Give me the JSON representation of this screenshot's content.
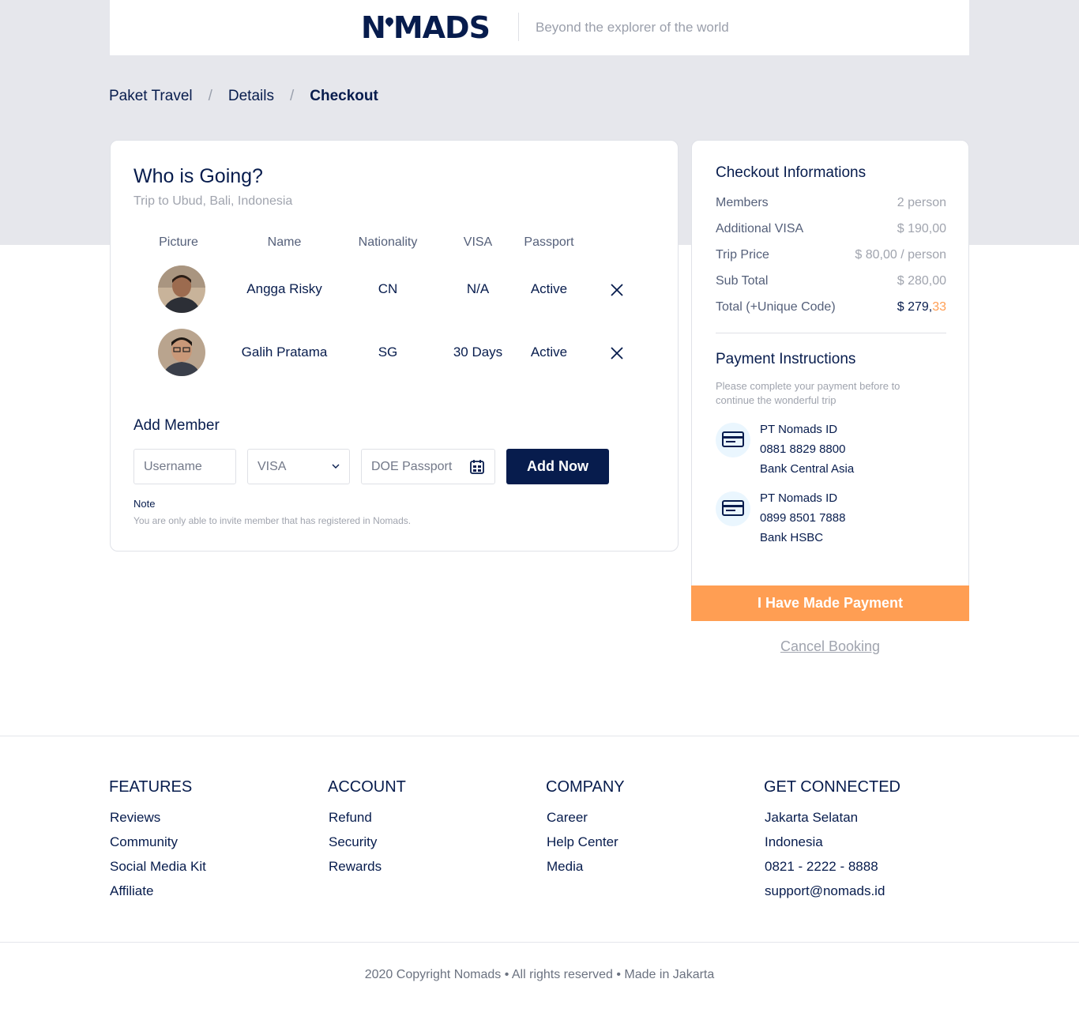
{
  "brand": {
    "logo_text_left": "N",
    "logo_text_right": "MADS",
    "tagline": "Beyond the explorer of the world"
  },
  "breadcrumb": {
    "items": [
      "Paket Travel",
      "Details",
      "Checkout"
    ],
    "separator": "/"
  },
  "who_going": {
    "title": "Who is Going?",
    "subtitle": "Trip to Ubud, Bali, Indonesia",
    "columns": [
      "Picture",
      "Name",
      "Nationality",
      "VISA",
      "Passport"
    ],
    "members": [
      {
        "name": "Angga Risky",
        "nationality": "CN",
        "visa": "N/A",
        "passport": "Active"
      },
      {
        "name": "Galih Pratama",
        "nationality": "SG",
        "visa": "30 Days",
        "passport": "Active"
      }
    ]
  },
  "add_member": {
    "title": "Add Member",
    "username_placeholder": "Username",
    "visa_selected": "VISA",
    "passport_placeholder": "DOE Passport",
    "button": "Add Now",
    "note_title": "Note",
    "note_text": "You are only able to invite member that has registered in Nomads."
  },
  "checkout": {
    "title": "Checkout Informations",
    "rows": [
      {
        "label": "Members",
        "value": "2 person"
      },
      {
        "label": "Additional VISA",
        "value": "$ 190,00"
      },
      {
        "label": "Trip Price",
        "value": "$ 80,00 / person"
      },
      {
        "label": "Sub Total",
        "value": "$ 280,00"
      }
    ],
    "total_label": "Total (+Unique Code)",
    "total_main": "$ 279,",
    "total_unique": "33",
    "accent_color": "#ff9e53"
  },
  "payment": {
    "title": "Payment Instructions",
    "note": "Please complete your payment before to continue the wonderful trip",
    "banks": [
      {
        "name": "PT Nomads ID",
        "account": "0881 8829 8800",
        "bank": "Bank Central Asia",
        "icon": "credit-card-icon"
      },
      {
        "name": "PT Nomads ID",
        "account": "0899 8501 7888",
        "bank": "Bank HSBC",
        "icon": "credit-card-icon"
      }
    ],
    "paid_button": "I Have Made Payment",
    "cancel": "Cancel Booking"
  },
  "footer": {
    "columns": [
      {
        "title": "FEATURES",
        "links": [
          "Reviews",
          "Community",
          "Social Media Kit",
          "Affiliate"
        ]
      },
      {
        "title": "ACCOUNT",
        "links": [
          "Refund",
          "Security",
          "Rewards"
        ]
      },
      {
        "title": "COMPANY",
        "links": [
          "Career",
          "Help Center",
          "Media"
        ]
      },
      {
        "title": "GET CONNECTED",
        "links": [
          "Jakarta Selatan",
          "Indonesia",
          "0821 - 2222 - 8888",
          "support@nomads.id"
        ]
      }
    ],
    "copyright": "2020 Copyright Nomads • All rights reserved • Made in Jakarta"
  },
  "colors": {
    "navy": "#071c4d",
    "orange": "#ff9e53",
    "band": "#e6e7ec"
  }
}
